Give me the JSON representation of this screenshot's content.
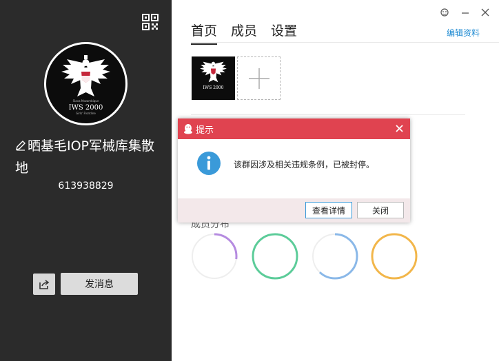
{
  "group": {
    "name": "晒基毛IOP军械库集散地",
    "id": "613938829",
    "send_message_label": "发消息"
  },
  "icons": {
    "qr": "qr-code-icon",
    "edit": "pencil-icon",
    "share": "share-icon",
    "skin": "skin-icon",
    "minimize": "minimize-icon",
    "close": "close-icon",
    "add": "plus-icon",
    "info": "info-icon",
    "qq": "qq-penguin-icon"
  },
  "avatar": {
    "emblem_lines": [
      "Slava Mozambique",
      "IWS 2000",
      "Girls' Frontline"
    ]
  },
  "tabs": [
    {
      "label": "首页",
      "active": true
    },
    {
      "label": "成员",
      "active": false
    },
    {
      "label": "设置",
      "active": false
    }
  ],
  "edit_profile_label": "编辑资料",
  "members_section": {
    "title_partial": "成员分布",
    "rings": [
      {
        "color": "#b58be0",
        "fraction": 0.27
      },
      {
        "color": "#5ccc99",
        "fraction": 1.0
      },
      {
        "color": "#8ab8e8",
        "fraction": 0.62
      },
      {
        "color": "#f2b64a",
        "fraction": 1.0
      }
    ]
  },
  "dialog": {
    "title": "提示",
    "message": "该群因涉及相关违规条例，已被封停。",
    "detail_button": "查看详情",
    "close_button": "关闭"
  },
  "colors": {
    "left_panel": "#2b2b2b",
    "dialog_header": "#e04350",
    "link": "#1e8ad2",
    "info_blue": "#3a9ad9"
  }
}
